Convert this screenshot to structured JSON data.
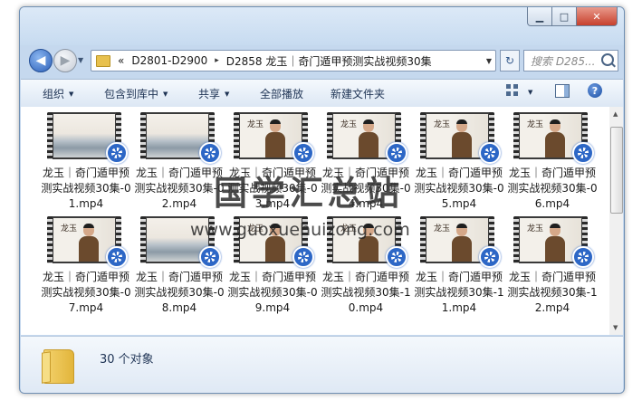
{
  "window": {
    "controls": {
      "minimize": "▁",
      "maximize": "□",
      "close": "✕"
    }
  },
  "address_bar": {
    "overflow": "«",
    "segments": [
      "D2801-D2900",
      "D2858 龙玉｜奇门遁甲预测实战视频30集"
    ],
    "separator": "▸"
  },
  "search": {
    "placeholder": "搜索 D285..."
  },
  "toolbar": {
    "organize": "组织",
    "include_in_library": "包含到库中",
    "share": "共享",
    "play_all": "全部播放",
    "new_folder": "新建文件夹"
  },
  "files": [
    {
      "name": "龙玉｜奇门遁甲预测实战视频30集-01.mp4",
      "thumb": "landscape"
    },
    {
      "name": "龙玉｜奇门遁甲预测实战视频30集-02.mp4",
      "thumb": "landscape"
    },
    {
      "name": "龙玉｜奇门遁甲预测实战视频30集-03.mp4",
      "thumb": "portrait"
    },
    {
      "name": "龙玉｜奇门遁甲预测实战视频30集-04.mp4",
      "thumb": "portrait"
    },
    {
      "name": "龙玉｜奇门遁甲预测实战视频30集-05.mp4",
      "thumb": "portrait"
    },
    {
      "name": "龙玉｜奇门遁甲预测实战视频30集-06.mp4",
      "thumb": "portrait"
    },
    {
      "name": "龙玉｜奇门遁甲预测实战视频30集-07.mp4",
      "thumb": "portrait"
    },
    {
      "name": "龙玉｜奇门遁甲预测实战视频30集-08.mp4",
      "thumb": "landscape"
    },
    {
      "name": "龙玉｜奇门遁甲预测实战视频30集-09.mp4",
      "thumb": "portrait"
    },
    {
      "name": "龙玉｜奇门遁甲预测实战视频30集-10.mp4",
      "thumb": "portrait"
    },
    {
      "name": "龙玉｜奇门遁甲预测实战视频30集-11.mp4",
      "thumb": "portrait"
    },
    {
      "name": "龙玉｜奇门遁甲预测实战视频30集-12.mp4",
      "thumb": "portrait"
    }
  ],
  "thumbnail_caption": "龙玉",
  "watermark": {
    "text": "国学汇总站",
    "url": "www.guoxuehuizong.com"
  },
  "details": {
    "count": "30 个对象"
  },
  "colors": {
    "reel": "#2d67c6",
    "folder": "#e8c14e",
    "chrome": "#c5d8ee"
  }
}
